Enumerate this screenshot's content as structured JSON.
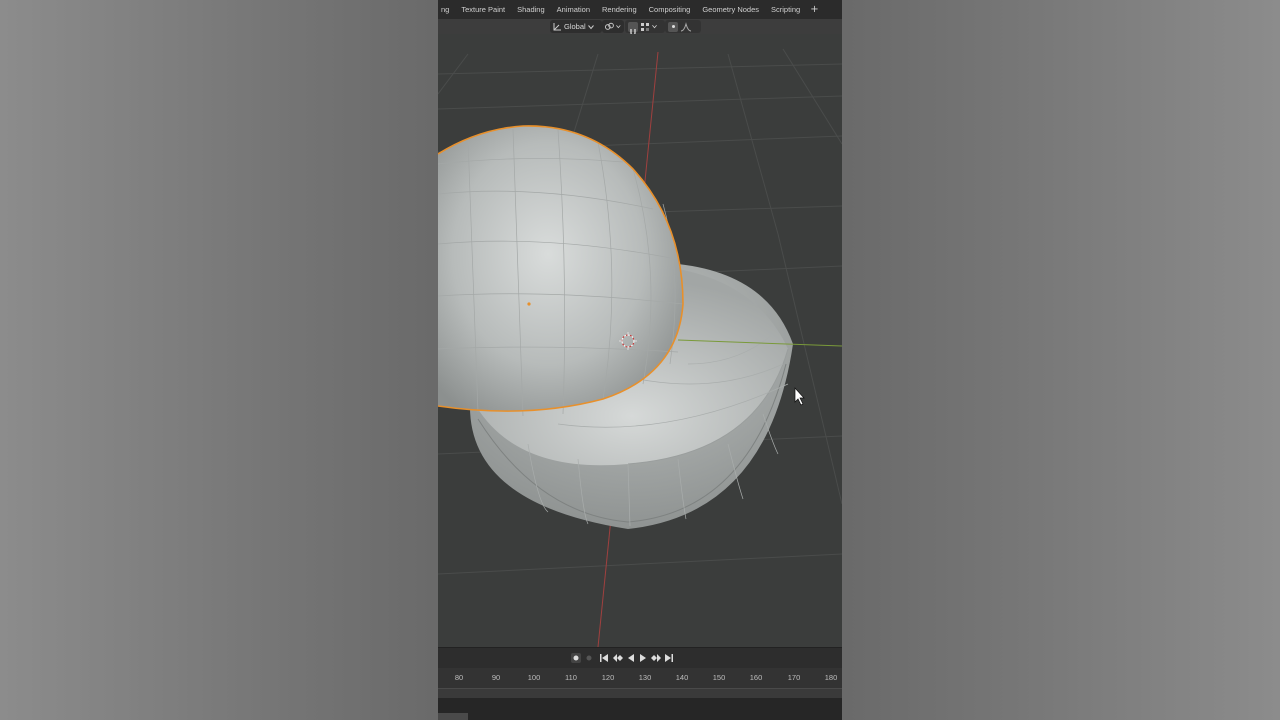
{
  "workspace_tabs": [
    "ng",
    "Texture Paint",
    "Shading",
    "Animation",
    "Rendering",
    "Compositing",
    "Geometry Nodes",
    "Scripting"
  ],
  "add_tab_symbol": "+",
  "transform_orientation": "Global",
  "timeline": {
    "frame_labels": [
      "80",
      "90",
      "100",
      "110",
      "120",
      "130",
      "140",
      "150",
      "160",
      "170",
      "180"
    ]
  },
  "colors": {
    "selection_outline": "#e8902b",
    "x_axis": "#a0403f",
    "y_axis": "#7a9a3a",
    "viewport_bg": "#3b3d3c"
  }
}
